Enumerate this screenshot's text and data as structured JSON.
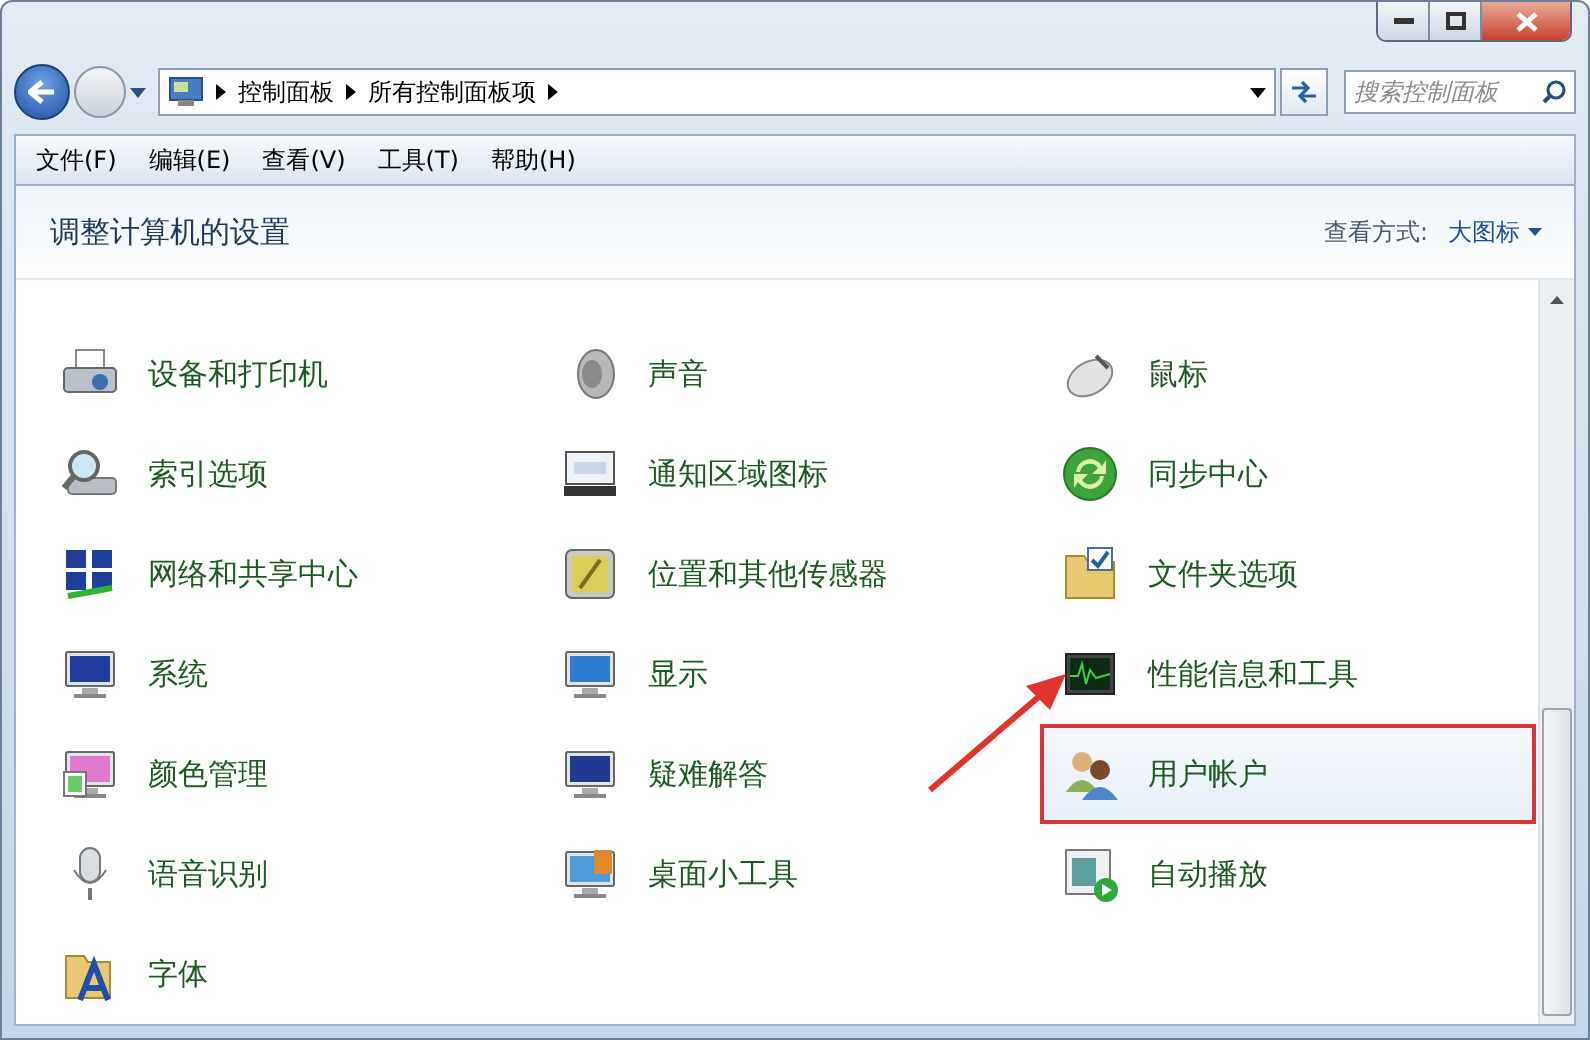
{
  "address_bar": {
    "breadcrumbs": [
      "控制面板",
      "所有控制面板项"
    ]
  },
  "search": {
    "placeholder": "搜索控制面板"
  },
  "menu": [
    "文件(F)",
    "编辑(E)",
    "查看(V)",
    "工具(T)",
    "帮助(H)"
  ],
  "header": {
    "title": "调整计算机的设置",
    "view_label": "查看方式:",
    "view_value": "大图标"
  },
  "items": [
    {
      "label": "设备和打印机",
      "highlighted": false
    },
    {
      "label": "声音",
      "highlighted": false
    },
    {
      "label": "鼠标",
      "highlighted": false
    },
    {
      "label": "索引选项",
      "highlighted": false
    },
    {
      "label": "通知区域图标",
      "highlighted": false
    },
    {
      "label": "同步中心",
      "highlighted": false
    },
    {
      "label": "网络和共享中心",
      "highlighted": false
    },
    {
      "label": "位置和其他传感器",
      "highlighted": false
    },
    {
      "label": "文件夹选项",
      "highlighted": false
    },
    {
      "label": "系统",
      "highlighted": false
    },
    {
      "label": "显示",
      "highlighted": false
    },
    {
      "label": "性能信息和工具",
      "highlighted": false
    },
    {
      "label": "颜色管理",
      "highlighted": false
    },
    {
      "label": "疑难解答",
      "highlighted": false
    },
    {
      "label": "用户帐户",
      "highlighted": true
    },
    {
      "label": "语音识别",
      "highlighted": false
    },
    {
      "label": "桌面小工具",
      "highlighted": false
    },
    {
      "label": "自动播放",
      "highlighted": false
    },
    {
      "label": "字体",
      "highlighted": false
    }
  ]
}
